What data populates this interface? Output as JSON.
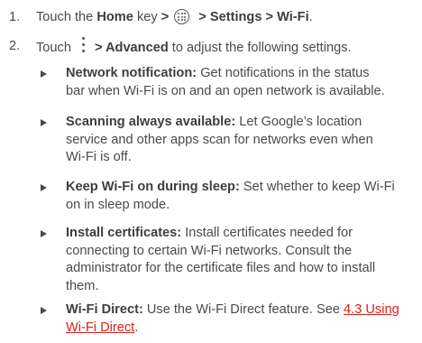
{
  "steps": [
    {
      "number": "1.",
      "prefix": "Touch the ",
      "home_key": "Home",
      "after_home": " key ",
      "arrow1": ">",
      "arrow2": " > ",
      "path_bold": "Settings > Wi-Fi",
      "end": ".",
      "apps_icon": "apps-drawer-icon"
    },
    {
      "number": "2.",
      "prefix": "Touch",
      "menu_icon": "overflow-menu-icon",
      "path_bold": "> Advanced",
      "rest": " to adjust the following settings."
    }
  ],
  "settings": [
    {
      "term": "Network notification:",
      "line1": " Get notifications in the status",
      "line2": "bar when Wi-Fi is on and an open network is available."
    },
    {
      "term": "Scanning always available:",
      "line1": " Let Google’s location",
      "line2": "service and other apps scan for networks even when",
      "line3": "Wi-Fi is off."
    },
    {
      "term": "Keep Wi-Fi on during sleep:",
      "line1": " Set whether to keep Wi-Fi",
      "line2": "on in sleep mode."
    },
    {
      "term": "Install certificates:",
      "line1": " Install certificates needed for",
      "line2": "connecting to certain Wi-Fi networks. Consult the",
      "line3": "administrator for the certificate files and how to install",
      "line4": "them."
    },
    {
      "term": "Wi-Fi Direct:",
      "line1": " Use the Wi-Fi Direct feature. See ",
      "link_part1": "4.3 Using",
      "link_part2": "Wi-Fi Direct",
      "end": "."
    }
  ],
  "colors": {
    "text": "#4a4a4a",
    "link": "#d6231a"
  }
}
